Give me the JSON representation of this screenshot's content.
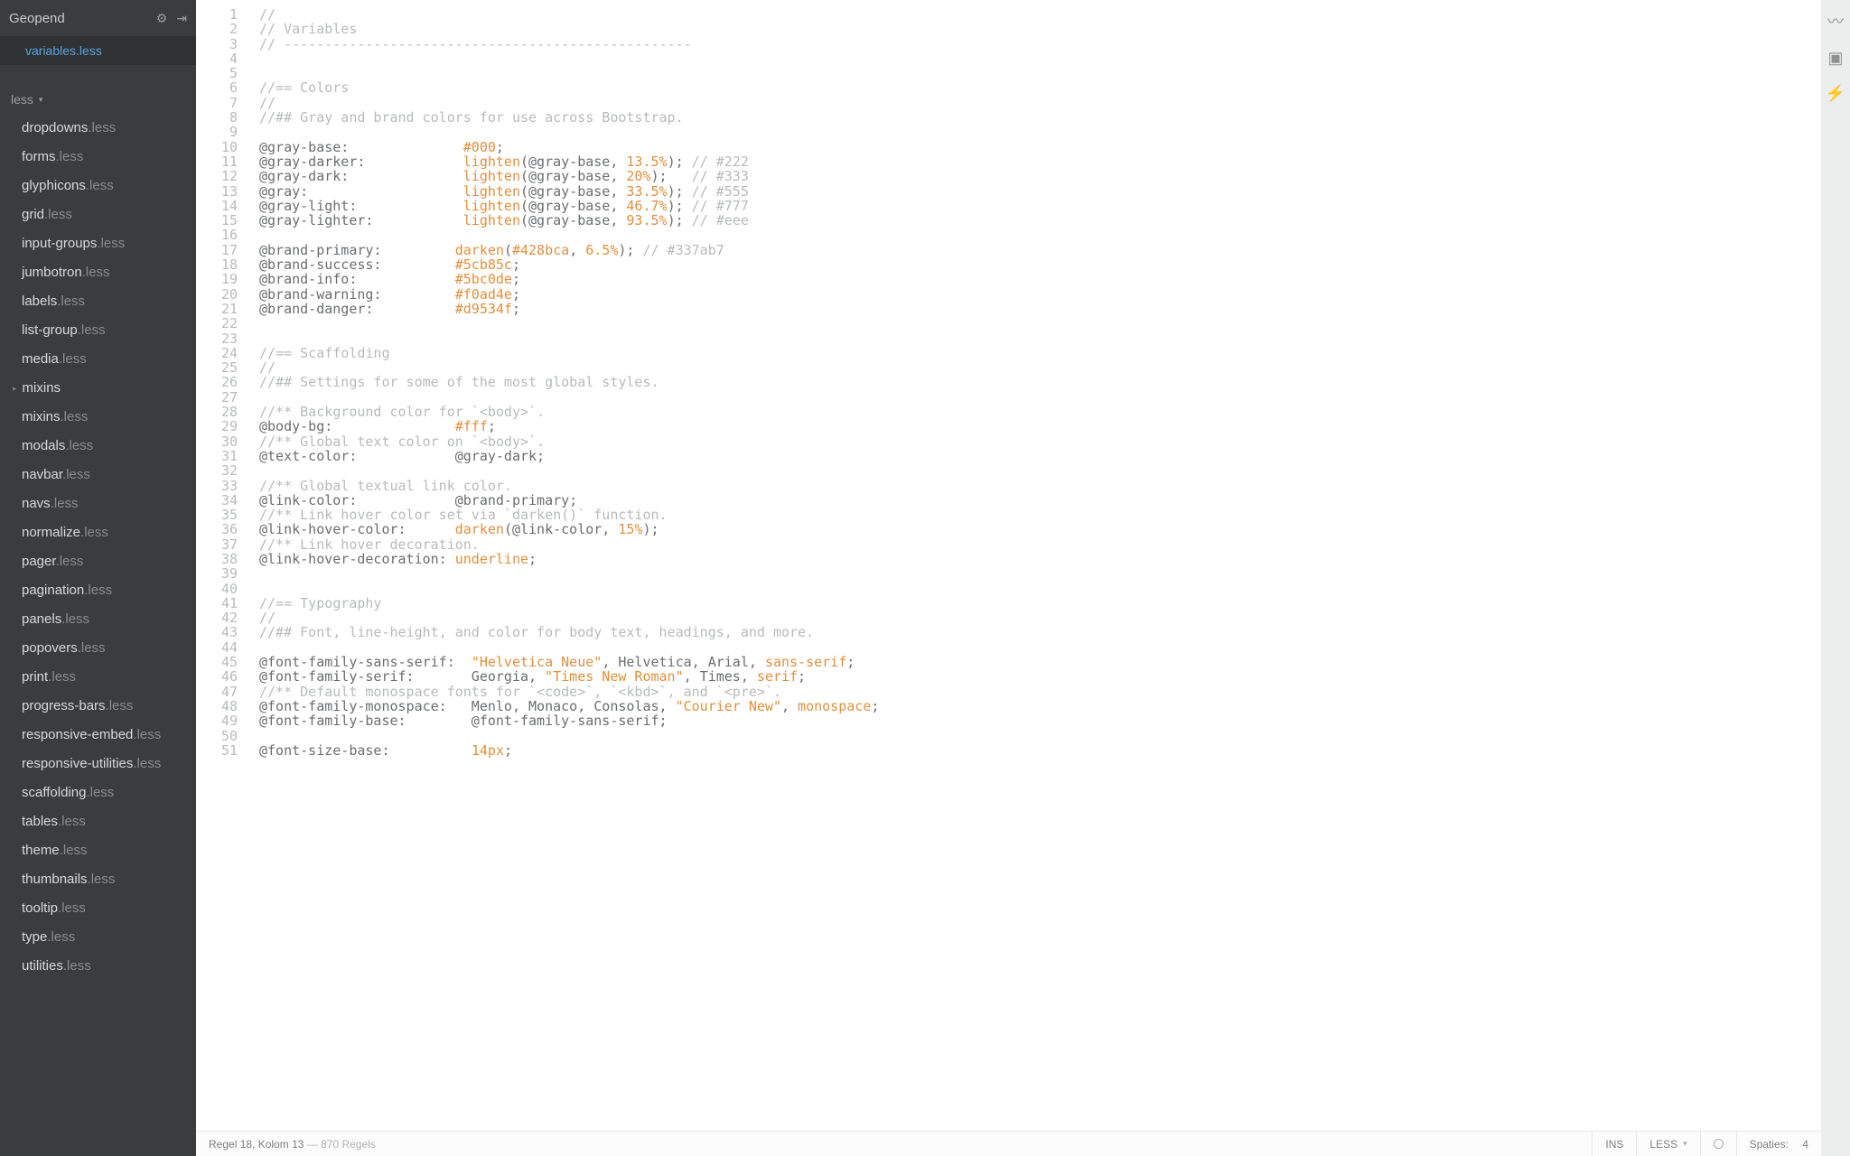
{
  "sidebar": {
    "title": "Geopend",
    "open_tab": "variables.less",
    "section": "less",
    "files": [
      {
        "name": "dropdowns",
        "ext": ".less"
      },
      {
        "name": "forms",
        "ext": ".less"
      },
      {
        "name": "glyphicons",
        "ext": ".less"
      },
      {
        "name": "grid",
        "ext": ".less"
      },
      {
        "name": "input-groups",
        "ext": ".less"
      },
      {
        "name": "jumbotron",
        "ext": ".less"
      },
      {
        "name": "labels",
        "ext": ".less"
      },
      {
        "name": "list-group",
        "ext": ".less"
      },
      {
        "name": "media",
        "ext": ".less"
      },
      {
        "name": "mixins",
        "folder": true
      },
      {
        "name": "mixins",
        "ext": ".less"
      },
      {
        "name": "modals",
        "ext": ".less"
      },
      {
        "name": "navbar",
        "ext": ".less"
      },
      {
        "name": "navs",
        "ext": ".less"
      },
      {
        "name": "normalize",
        "ext": ".less"
      },
      {
        "name": "pager",
        "ext": ".less"
      },
      {
        "name": "pagination",
        "ext": ".less"
      },
      {
        "name": "panels",
        "ext": ".less"
      },
      {
        "name": "popovers",
        "ext": ".less"
      },
      {
        "name": "print",
        "ext": ".less"
      },
      {
        "name": "progress-bars",
        "ext": ".less"
      },
      {
        "name": "responsive-embed",
        "ext": ".less"
      },
      {
        "name": "responsive-utilities",
        "ext": ".less"
      },
      {
        "name": "scaffolding",
        "ext": ".less"
      },
      {
        "name": "tables",
        "ext": ".less"
      },
      {
        "name": "theme",
        "ext": ".less"
      },
      {
        "name": "thumbnails",
        "ext": ".less"
      },
      {
        "name": "tooltip",
        "ext": ".less"
      },
      {
        "name": "type",
        "ext": ".less"
      },
      {
        "name": "utilities",
        "ext": ".less"
      }
    ]
  },
  "editor": {
    "lines": [
      [
        {
          "t": "comment",
          "s": "//"
        }
      ],
      [
        {
          "t": "comment",
          "s": "// Variables"
        }
      ],
      [
        {
          "t": "comment",
          "s": "// --------------------------------------------------"
        }
      ],
      [],
      [],
      [
        {
          "t": "comment",
          "s": "//== Colors"
        }
      ],
      [
        {
          "t": "comment",
          "s": "//"
        }
      ],
      [
        {
          "t": "comment",
          "s": "//## Gray and brand colors for use across Bootstrap."
        }
      ],
      [],
      [
        {
          "t": "var",
          "s": "@gray-base:              "
        },
        {
          "t": "hex",
          "s": "#000"
        },
        {
          "t": "punc",
          "s": ";"
        }
      ],
      [
        {
          "t": "var",
          "s": "@gray-darker:            "
        },
        {
          "t": "fn",
          "s": "lighten"
        },
        {
          "t": "punc",
          "s": "(@gray-base, "
        },
        {
          "t": "pct",
          "s": "13.5%"
        },
        {
          "t": "punc",
          "s": "); "
        },
        {
          "t": "comment",
          "s": "// #222"
        }
      ],
      [
        {
          "t": "var",
          "s": "@gray-dark:              "
        },
        {
          "t": "fn",
          "s": "lighten"
        },
        {
          "t": "punc",
          "s": "(@gray-base, "
        },
        {
          "t": "pct",
          "s": "20%"
        },
        {
          "t": "punc",
          "s": ");   "
        },
        {
          "t": "comment",
          "s": "// #333"
        }
      ],
      [
        {
          "t": "var",
          "s": "@gray:                   "
        },
        {
          "t": "fn",
          "s": "lighten"
        },
        {
          "t": "punc",
          "s": "(@gray-base, "
        },
        {
          "t": "pct",
          "s": "33.5%"
        },
        {
          "t": "punc",
          "s": "); "
        },
        {
          "t": "comment",
          "s": "// #555"
        }
      ],
      [
        {
          "t": "var",
          "s": "@gray-light:             "
        },
        {
          "t": "fn",
          "s": "lighten"
        },
        {
          "t": "punc",
          "s": "(@gray-base, "
        },
        {
          "t": "pct",
          "s": "46.7%"
        },
        {
          "t": "punc",
          "s": "); "
        },
        {
          "t": "comment",
          "s": "// #777"
        }
      ],
      [
        {
          "t": "var",
          "s": "@gray-lighter:           "
        },
        {
          "t": "fn",
          "s": "lighten"
        },
        {
          "t": "punc",
          "s": "(@gray-base, "
        },
        {
          "t": "pct",
          "s": "93.5%"
        },
        {
          "t": "punc",
          "s": "); "
        },
        {
          "t": "comment",
          "s": "// #eee"
        }
      ],
      [],
      [
        {
          "t": "var",
          "s": "@brand-primary:         "
        },
        {
          "t": "fn",
          "s": "darken"
        },
        {
          "t": "punc",
          "s": "("
        },
        {
          "t": "hex",
          "s": "#428bca"
        },
        {
          "t": "punc",
          "s": ", "
        },
        {
          "t": "pct",
          "s": "6.5%"
        },
        {
          "t": "punc",
          "s": "); "
        },
        {
          "t": "comment",
          "s": "// #337ab7"
        }
      ],
      [
        {
          "t": "var",
          "s": "@brand-success:         "
        },
        {
          "t": "hex",
          "s": "#5cb85c"
        },
        {
          "t": "punc",
          "s": ";"
        }
      ],
      [
        {
          "t": "var",
          "s": "@brand-info:            "
        },
        {
          "t": "hex",
          "s": "#5bc0de"
        },
        {
          "t": "punc",
          "s": ";"
        }
      ],
      [
        {
          "t": "var",
          "s": "@brand-warning:         "
        },
        {
          "t": "hex",
          "s": "#f0ad4e"
        },
        {
          "t": "punc",
          "s": ";"
        }
      ],
      [
        {
          "t": "var",
          "s": "@brand-danger:          "
        },
        {
          "t": "hex",
          "s": "#d9534f"
        },
        {
          "t": "punc",
          "s": ";"
        }
      ],
      [],
      [],
      [
        {
          "t": "comment",
          "s": "//== Scaffolding"
        }
      ],
      [
        {
          "t": "comment",
          "s": "//"
        }
      ],
      [
        {
          "t": "comment",
          "s": "//## Settings for some of the most global styles."
        }
      ],
      [],
      [
        {
          "t": "comment",
          "s": "//** Background color for `<body>`."
        }
      ],
      [
        {
          "t": "var",
          "s": "@body-bg:               "
        },
        {
          "t": "hex",
          "s": "#fff"
        },
        {
          "t": "punc",
          "s": ";"
        }
      ],
      [
        {
          "t": "comment",
          "s": "//** Global text color on `<body>`."
        }
      ],
      [
        {
          "t": "var",
          "s": "@text-color:            @gray-dark;"
        }
      ],
      [],
      [
        {
          "t": "comment",
          "s": "//** Global textual link color."
        }
      ],
      [
        {
          "t": "var",
          "s": "@link-color:            @brand-primary;"
        }
      ],
      [
        {
          "t": "comment",
          "s": "//** Link hover color set via `darken()` function."
        }
      ],
      [
        {
          "t": "var",
          "s": "@link-hover-color:      "
        },
        {
          "t": "fn",
          "s": "darken"
        },
        {
          "t": "punc",
          "s": "(@link-color, "
        },
        {
          "t": "pct",
          "s": "15%"
        },
        {
          "t": "punc",
          "s": ");"
        }
      ],
      [
        {
          "t": "comment",
          "s": "//** Link hover decoration."
        }
      ],
      [
        {
          "t": "var",
          "s": "@link-hover-decoration: "
        },
        {
          "t": "kw",
          "s": "underline"
        },
        {
          "t": "punc",
          "s": ";"
        }
      ],
      [],
      [],
      [
        {
          "t": "comment",
          "s": "//== Typography"
        }
      ],
      [
        {
          "t": "comment",
          "s": "//"
        }
      ],
      [
        {
          "t": "comment",
          "s": "//## Font, line-height, and color for body text, headings, and more."
        }
      ],
      [],
      [
        {
          "t": "var",
          "s": "@font-family-sans-serif:  "
        },
        {
          "t": "str",
          "s": "\"Helvetica Neue\""
        },
        {
          "t": "punc",
          "s": ", Helvetica, Arial, "
        },
        {
          "t": "kw",
          "s": "sans-serif"
        },
        {
          "t": "punc",
          "s": ";"
        }
      ],
      [
        {
          "t": "var",
          "s": "@font-family-serif:       Georgia, "
        },
        {
          "t": "str",
          "s": "\"Times New Roman\""
        },
        {
          "t": "punc",
          "s": ", Times, "
        },
        {
          "t": "kw",
          "s": "serif"
        },
        {
          "t": "punc",
          "s": ";"
        }
      ],
      [
        {
          "t": "comment",
          "s": "//** Default monospace fonts for `<code>`, `<kbd>`, and `<pre>`."
        }
      ],
      [
        {
          "t": "var",
          "s": "@font-family-monospace:   Menlo, Monaco, Consolas, "
        },
        {
          "t": "str",
          "s": "\"Courier New\""
        },
        {
          "t": "punc",
          "s": ", "
        },
        {
          "t": "kw",
          "s": "monospace"
        },
        {
          "t": "punc",
          "s": ";"
        }
      ],
      [
        {
          "t": "var",
          "s": "@font-family-base:        @font-family-sans-serif;"
        }
      ],
      [],
      [
        {
          "t": "var",
          "s": "@font-size-base:          "
        },
        {
          "t": "num",
          "s": "14px"
        },
        {
          "t": "punc",
          "s": ";"
        }
      ]
    ]
  },
  "statusbar": {
    "pos_prefix": "Regel ",
    "line": "18",
    "pos_mid": ", Kolom ",
    "col": "13",
    "total_sep": " — ",
    "total": "870 Regels",
    "ins": "INS",
    "lang": "LESS",
    "spaces_label": "Spaties:",
    "spaces_val": "4"
  }
}
